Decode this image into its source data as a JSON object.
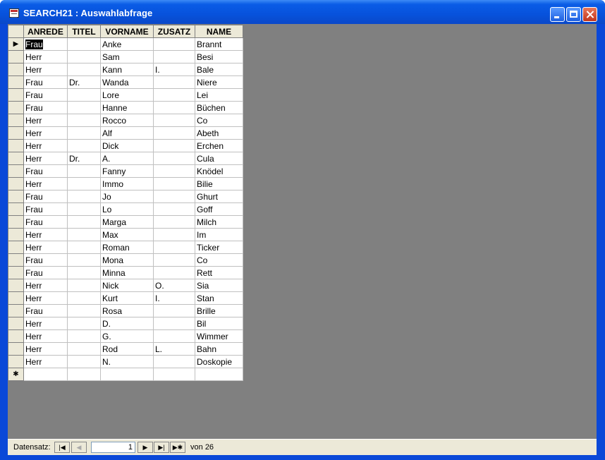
{
  "window": {
    "title": "SEARCH21 : Auswahlabfrage"
  },
  "grid": {
    "columns": [
      "ANREDE",
      "TITEL",
      "VORNAME",
      "ZUSATZ",
      "NAME"
    ],
    "rows": [
      [
        "Frau",
        "",
        "Anke",
        "",
        "Brannt"
      ],
      [
        "Herr",
        "",
        "Sam",
        "",
        "Besi"
      ],
      [
        "Herr",
        "",
        "Kann",
        "I.",
        "Bale"
      ],
      [
        "Frau",
        "Dr.",
        "Wanda",
        "",
        "Niere"
      ],
      [
        "Frau",
        "",
        "Lore",
        "",
        "Lei"
      ],
      [
        "Frau",
        "",
        "Hanne",
        "",
        "Büchen"
      ],
      [
        "Herr",
        "",
        "Rocco",
        "",
        "Co"
      ],
      [
        "Herr",
        "",
        "Alf",
        "",
        "Abeth"
      ],
      [
        "Herr",
        "",
        "Dick",
        "",
        "Erchen"
      ],
      [
        "Herr",
        "Dr.",
        "A.",
        "",
        "Cula"
      ],
      [
        "Frau",
        "",
        "Fanny",
        "",
        "Knödel"
      ],
      [
        "Herr",
        "",
        "Immo",
        "",
        "Bilie"
      ],
      [
        "Frau",
        "",
        "Jo",
        "",
        "Ghurt"
      ],
      [
        "Frau",
        "",
        "Lo",
        "",
        "Goff"
      ],
      [
        "Frau",
        "",
        "Marga",
        "",
        "Milch"
      ],
      [
        "Herr",
        "",
        "Max",
        "",
        "Im"
      ],
      [
        "Herr",
        "",
        "Roman",
        "",
        "Ticker"
      ],
      [
        "Frau",
        "",
        "Mona",
        "",
        "Co"
      ],
      [
        "Frau",
        "",
        "Minna",
        "",
        "Rett"
      ],
      [
        "Herr",
        "",
        "Nick",
        "O.",
        "Sia"
      ],
      [
        "Herr",
        "",
        "Kurt",
        "I.",
        "Stan"
      ],
      [
        "Frau",
        "",
        "Rosa",
        "",
        "Brille"
      ],
      [
        "Herr",
        "",
        "D.",
        "",
        "Bil"
      ],
      [
        "Herr",
        "",
        "G.",
        "",
        "Wimmer"
      ],
      [
        "Herr",
        "",
        "Rod",
        "L.",
        "Bahn"
      ],
      [
        "Herr",
        "",
        "N.",
        "",
        "Doskopie"
      ]
    ],
    "current_record_marker": "▶",
    "new_record_marker": "✱"
  },
  "navigation": {
    "label": "Datensatz:",
    "current_record": "1",
    "of_label": "von",
    "total_records": "26",
    "first_glyph": "|◀",
    "prev_glyph": "◀",
    "next_glyph": "▶",
    "last_glyph": "▶|",
    "new_glyph": "▶✱"
  },
  "colors": {
    "titlebar": "#0752dc",
    "client_background": "#808080",
    "selection": "#000000"
  }
}
